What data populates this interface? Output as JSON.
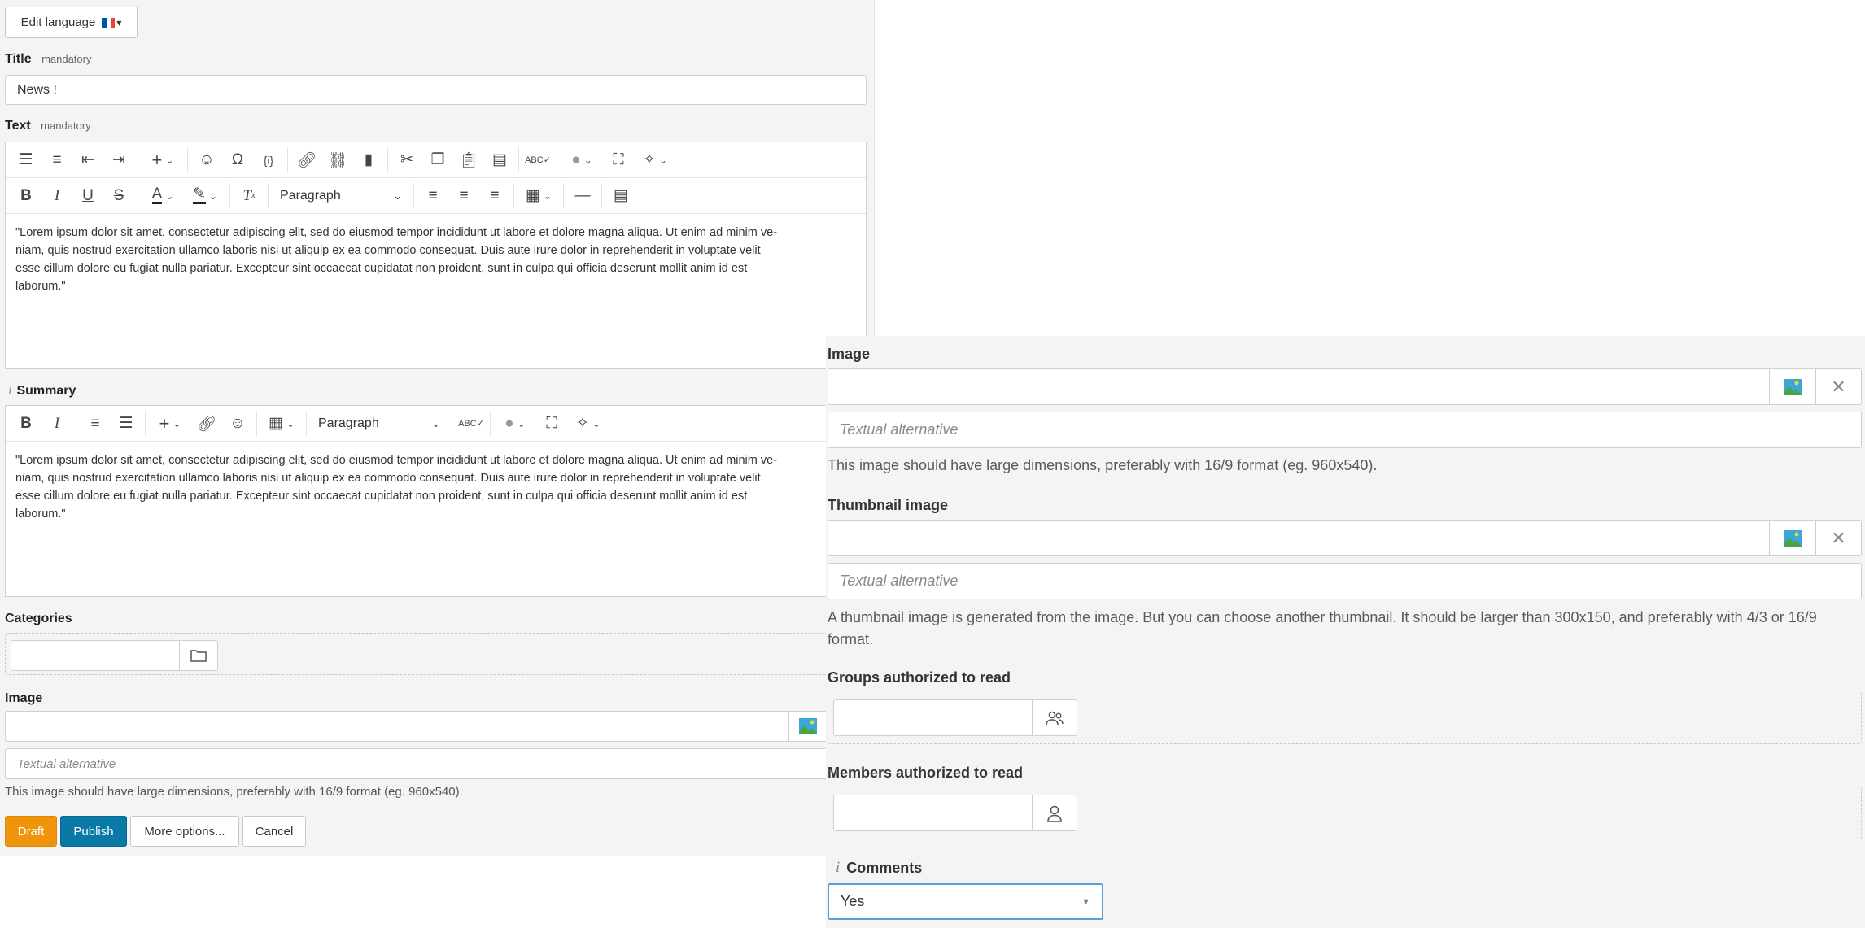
{
  "edit_language": {
    "label": "Edit language",
    "flag": "FR",
    "caret": "▾"
  },
  "title_field": {
    "label": "Title",
    "note": "mandatory",
    "value": "News !"
  },
  "text_field": {
    "label": "Text",
    "note": "mandatory",
    "format_label": "Paragraph",
    "content": "\"Lorem ipsum dolor sit amet, consectetur adipiscing elit, sed do eiusmod tempor incididunt ut labore et dolore magna aliqua. Ut enim ad minim ve-niam, quis nostrud exercitation ullamco laboris nisi ut aliquip ex ea commodo consequat. Duis aute irure dolor in reprehenderit in voluptate velit esse cillum dolore eu fugiat nulla pariatur. Excepteur sint occaecat cupidatat non proident, sunt in culpa qui officia deserunt mollit anim id est laborum.\"",
    "lines": [
      "\"Lorem ipsum dolor sit amet, consectetur adipiscing elit, sed do eiusmod tempor incididunt ut labore et dolore magna aliqua. Ut enim ad minim ve-",
      "niam, quis nostrud exercitation ullamco laboris nisi ut aliquip ex ea commodo consequat. Duis aute irure dolor in reprehenderit in voluptate velit",
      "esse cillum dolore eu fugiat nulla pariatur. Excepteur sint occaecat cupidatat non proident, sunt in culpa qui officia deserunt mollit anim id est",
      "laborum.\""
    ]
  },
  "summary_field": {
    "info": "i",
    "label": "Summary",
    "format_label": "Paragraph",
    "lines": [
      "\"Lorem ipsum dolor sit amet, consectetur adipiscing elit, sed do eiusmod tempor incididunt ut labore et dolore magna aliqua. Ut enim ad minim ve-",
      "niam, quis nostrud exercitation ullamco laboris nisi ut aliquip ex ea commodo consequat. Duis aute irure dolor in reprehenderit in voluptate velit",
      "esse cillum dolore eu fugiat nulla pariatur. Excepteur sint occaecat cupidatat non proident, sunt in culpa qui officia deserunt mollit anim id est",
      "laborum.\""
    ]
  },
  "categories_field": {
    "label": "Categories"
  },
  "left_image": {
    "label": "Image",
    "alt_placeholder": "Textual alternative",
    "help": "This image should have large dimensions, preferably with 16/9 format (eg. 960x540)."
  },
  "actions": {
    "draft": "Draft",
    "publish": "Publish",
    "more": "More options...",
    "cancel": "Cancel"
  },
  "right": {
    "image": {
      "label": "Image",
      "alt_placeholder": "Textual alternative",
      "help": "This image should have large dimensions, preferably with 16/9 format (eg. 960x540)."
    },
    "thumbnail": {
      "label": "Thumbnail image",
      "alt_placeholder": "Textual alternative",
      "help": "A thumbnail image is generated from the image. But you can choose another thumbnail. It should be larger than 300x150, and preferably with 4/3 or 16/9 format."
    },
    "groups": {
      "label": "Groups authorized to read"
    },
    "members": {
      "label": "Members authorized to read"
    },
    "comments": {
      "info": "i",
      "label": "Comments",
      "value": "Yes"
    }
  },
  "colors": {
    "draft": "#f0950b",
    "publish": "#0a79a8",
    "panel_bg": "#f4f4f4",
    "focus_border": "#5b9fd6",
    "flag_blue": "#0055a4",
    "flag_red": "#ef4135"
  },
  "icons": {
    "image_picker": "image-icon",
    "clear": "close-icon",
    "folder": "folder-icon",
    "groups": "group-icon",
    "member": "user-icon",
    "dropdown": "caret-down-icon"
  }
}
